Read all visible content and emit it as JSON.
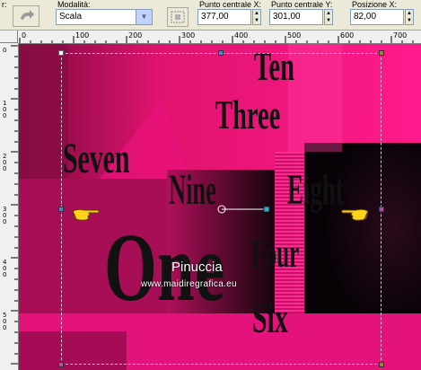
{
  "toolbar": {
    "cut_label": "r:",
    "mode_label": "Modalità:",
    "mode_value": "Scala",
    "center_x_label": "Punto centrale X:",
    "center_x_value": "377,00",
    "center_y_label": "Punto centrale Y:",
    "center_y_value": "301,00",
    "position_x_label": "Posizione X:",
    "position_x_value": "82,00",
    "undo_icon": "undo-arrow-icon",
    "transform_icon": "transform-frame-icon"
  },
  "ruler_top": {
    "labels": [
      "0",
      "100",
      "200",
      "300",
      "400",
      "500",
      "600",
      "700"
    ]
  },
  "ruler_left": {
    "labels": [
      "0",
      "100",
      "200",
      "300",
      "400",
      "500"
    ]
  },
  "canvas": {
    "background_color": "#ff1a8c",
    "words": {
      "ten": "Ten",
      "three": "Three",
      "seven": "Seven",
      "nine": "Nine",
      "eight": "Eight",
      "one": "One",
      "four": "Four",
      "six": "Six"
    },
    "watermark_title": "Pinuccia",
    "watermark_url": "www.maidiregrafica.eu",
    "left_hand_icon": "pointing-hand-right-icon",
    "right_hand_icon": "pointing-hand-left-icon"
  }
}
